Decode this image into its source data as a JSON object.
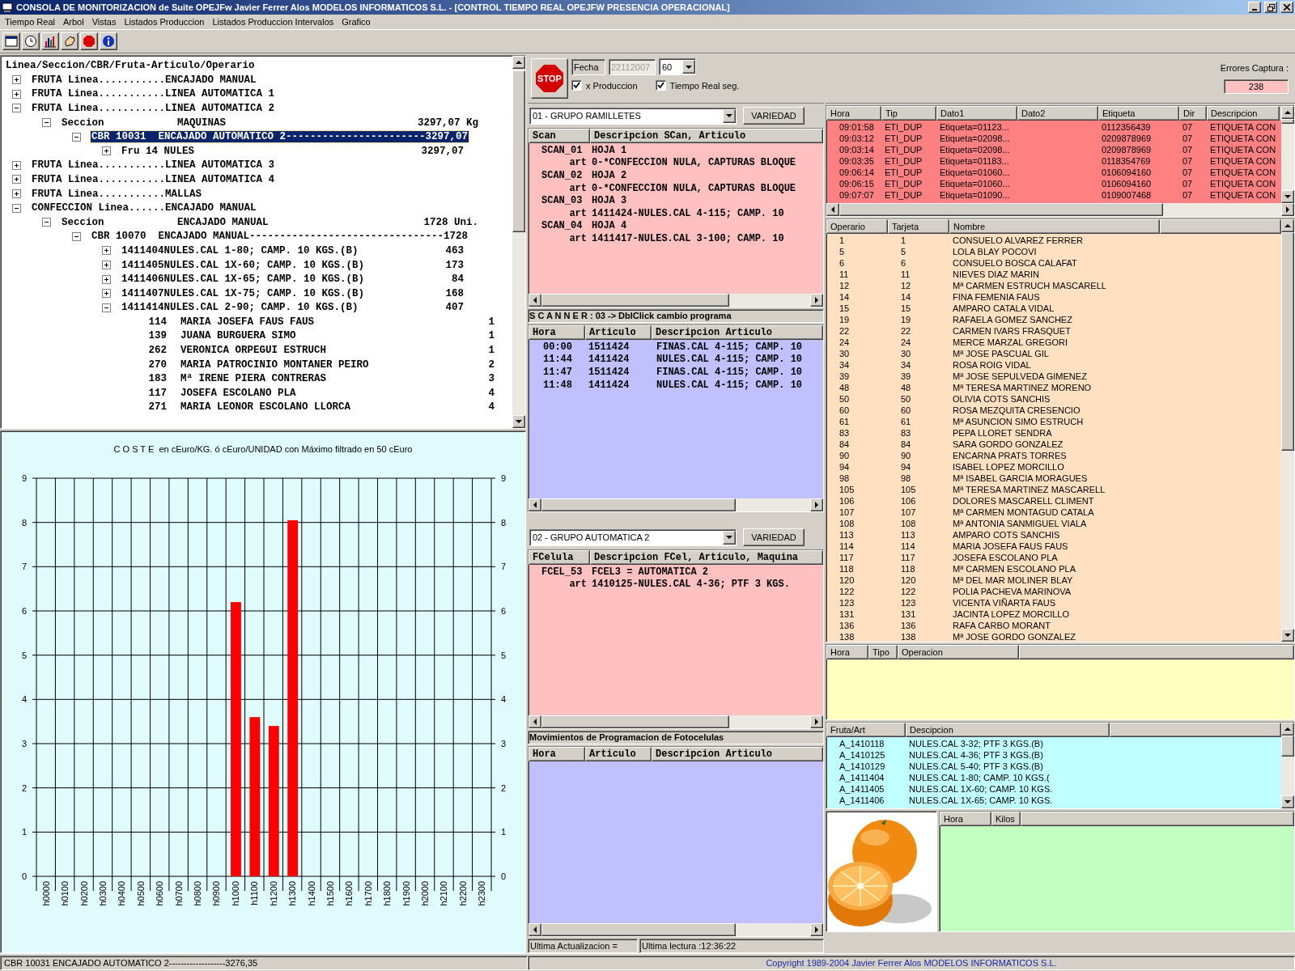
{
  "window": {
    "title": "CONSOLA DE MONITORIZACION de Suite OPEJFw Javier Ferrer Alos MODELOS INFORMATICOS S.L. - [CONTROL TIEMPO REAL OPEJFW PRESENCIA OPERACIONAL]"
  },
  "menu": [
    "Tiempo Real",
    "Arbol",
    "Vistas",
    "Listados Produccion",
    "Listados Produccion Intervalos",
    "Grafico"
  ],
  "tree": {
    "header": "Linea/Seccion/CBR/Fruta-Articulo/Operario",
    "items": [
      {
        "label": "FRUTA Linea...........ENCAJADO MANUAL",
        "expanded": false,
        "selected": false
      },
      {
        "label": "FRUTA Linea...........LINEA AUTOMATICA 1",
        "expanded": false,
        "selected": false
      },
      {
        "label": "FRUTA Linea...........LINEA AUTOMATICA 2",
        "expanded": true,
        "selected": false,
        "children": [
          {
            "label": "Seccion",
            "detail": "MAQUINAS",
            "value": "3297,07 Kg",
            "expanded": true,
            "selected": false,
            "children": [
              {
                "label": "CBR 10031  ENCAJADO AUTOMATICO 2-----------------------3297,07",
                "expanded": true,
                "selected": true,
                "children": [
                  {
                    "label": "Fru 14 NULES",
                    "value": "3297,07",
                    "expanded": false,
                    "selected": false
                  }
                ]
              }
            ]
          }
        ]
      },
      {
        "label": "FRUTA Linea...........LINEA AUTOMATICA 3",
        "expanded": false,
        "selected": false
      },
      {
        "label": "FRUTA Linea...........LINEA AUTOMATICA 4",
        "expanded": false,
        "selected": false
      },
      {
        "label": "FRUTA Linea...........MALLAS",
        "expanded": false,
        "selected": false
      },
      {
        "label": "CONFECCION Linea......ENCAJADO MANUAL",
        "expanded": true,
        "selected": false,
        "children": [
          {
            "label": "Seccion",
            "detail": "ENCAJADO MANUAL",
            "value": "1728 Uni.",
            "expanded": true,
            "selected": false,
            "children": [
              {
                "label": "CBR 10070  ENCAJADO MANUAL--------------------------------1728",
                "expanded": true,
                "selected": false,
                "children": [
                  {
                    "label": "1411404NULES.CAL 1-80; CAMP. 10 KGS.(B)",
                    "value": "463",
                    "expanded": false,
                    "selected": false
                  },
                  {
                    "label": "1411405NULES.CAL 1X-60; CAMP. 10 KGS.(B)",
                    "value": "173",
                    "expanded": false,
                    "selected": false
                  },
                  {
                    "label": "1411406NULES.CAL 1X-65; CAMP. 10 KGS.(B)",
                    "value": "84",
                    "expanded": false,
                    "selected": false
                  },
                  {
                    "label": "1411407NULES.CAL 1X-75; CAMP. 10 KGS.(B)",
                    "value": "168",
                    "expanded": false,
                    "selected": false
                  },
                  {
                    "label": "1411414NULES.CAL 2-90; CAMP. 10 KGS.(B)",
                    "value": "407",
                    "expanded": true,
                    "selected": false,
                    "children": [
                      {
                        "label": "114",
                        "detail": "MARIA JOSEFA FAUS FAUS",
                        "value": "1",
                        "selected": false
                      },
                      {
                        "label": "139",
                        "detail": "JUANA BURGUERA SIMO",
                        "value": "1",
                        "selected": false
                      },
                      {
                        "label": "262",
                        "detail": "VERONICA ORPEGUI ESTRUCH",
                        "value": "1",
                        "selected": false
                      },
                      {
                        "label": "270",
                        "detail": "MARIA PATROCINIO MONTANER PEIRO",
                        "value": "2",
                        "selected": false
                      },
                      {
                        "label": "183",
                        "detail": "Mª IRENE PIERA CONTRERAS",
                        "value": "3",
                        "selected": false
                      },
                      {
                        "label": "117",
                        "detail": "JOSEFA ESCOLANO PLA",
                        "value": "4",
                        "selected": false
                      },
                      {
                        "label": "271",
                        "detail": "MARIA LEONOR ESCOLANO LLORCA",
                        "value": "4",
                        "selected": false
                      }
                    ]
                  }
                ]
              }
            ]
          }
        ]
      }
    ]
  },
  "chart": {
    "chart_data": {
      "type": "bar",
      "title": "C O S T E  en cEuro/KG. ó cEuro/UNIDAD con Máximo filtrado en 50 cEuro",
      "categories": [
        "h0000",
        "h0100",
        "h0200",
        "h0300",
        "h0400",
        "h0500",
        "h0600",
        "h0700",
        "h0800",
        "h0900",
        "h1000",
        "h1100",
        "h1200",
        "h1300",
        "h1400",
        "h1500",
        "h1600",
        "h1700",
        "h1800",
        "h1900",
        "h2000",
        "h2100",
        "h2200",
        "h2300"
      ],
      "series": [
        {
          "color": "#ff0000",
          "values": [
            0,
            0,
            0,
            0,
            0,
            0,
            0,
            0,
            0,
            0,
            6.2,
            3.6,
            3.4,
            8.05,
            0,
            0,
            0,
            0,
            0,
            0,
            0,
            0,
            0,
            0
          ]
        }
      ],
      "ylim": [
        0,
        9
      ],
      "yticks": [
        0,
        1,
        2,
        3,
        4,
        5,
        6,
        7,
        8,
        9
      ],
      "grid": true
    },
    "left_axis_ticks": [
      "9",
      "8",
      "7",
      "6",
      "5",
      "4",
      "3",
      "2",
      "1",
      "0"
    ],
    "right_axis_ticks": [
      "9",
      "8",
      "7",
      "6",
      "5",
      "4",
      "3",
      "2",
      "1",
      "0"
    ]
  },
  "controls": {
    "stop_button": "STOP",
    "date_label": "Fecha",
    "date_value": "22112007",
    "interval": "60",
    "checkboxes": [
      {
        "label": "x Produccion",
        "checked": true
      },
      {
        "label": "Tiempo Real seg.",
        "checked": true
      }
    ]
  },
  "scan_group": {
    "combo": "01 - GRUPO RAMILLETES",
    "button": "VARIEDAD",
    "columns": [
      "Scan",
      "Descripcion SCan, Articulo"
    ],
    "rows": [
      {
        "kind": "scan",
        "code": "SCAN_01",
        "text": "HOJA 1"
      },
      {
        "kind": "art",
        "code": "art",
        "text": "0-*CONFECCION NULA, CAPTURAS BLOQUE"
      },
      {
        "kind": "scan",
        "code": "SCAN_02",
        "text": "HOJA 2"
      },
      {
        "kind": "art",
        "code": "art",
        "text": "0-*CONFECCION NULA, CAPTURAS BLOQUE"
      },
      {
        "kind": "scan",
        "code": "SCAN_03",
        "text": "HOJA 3"
      },
      {
        "kind": "art",
        "code": "art",
        "text": "1411424-NULES.CAL 4-115; CAMP. 10"
      },
      {
        "kind": "scan",
        "code": "SCAN_04",
        "text": "HOJA 4"
      },
      {
        "kind": "art",
        "code": "art",
        "text": "1411417-NULES.CAL 3-100; CAMP. 10"
      }
    ]
  },
  "scanner": {
    "label": "S C A N N E R : 03 -> DblClick cambio programa",
    "columns": [
      "Hora",
      "Articulo",
      "Descripcion Articulo"
    ],
    "rows": [
      [
        "00:00",
        "1511424",
        "FINAS.CAL 4-115; CAMP. 10"
      ],
      [
        "11:44",
        "1411424",
        "NULES.CAL 4-115; CAMP. 10"
      ],
      [
        "11:47",
        "1511424",
        "FINAS.CAL 4-115; CAMP. 10"
      ],
      [
        "11:48",
        "1411424",
        "NULES.CAL 4-115; CAMP. 10"
      ]
    ]
  },
  "fcel_group": {
    "combo": "02 - GRUPO AUTOMATICA 2",
    "button": "VARIEDAD",
    "columns": [
      "FCelula",
      "Descripcion FCel, Articulo, Maquina"
    ],
    "rows": [
      {
        "kind": "scan",
        "code": "FCEL_53",
        "text": "FCEL3 = AUTOMATICA 2"
      },
      {
        "kind": "art",
        "code": "art",
        "text": "1410125-NULES.CAL 4-36; PTF 3 KGS."
      }
    ]
  },
  "movements": {
    "label": "Movimientos de Programacion de Fotocelulas",
    "columns": [
      "Hora",
      "Articulo",
      "Descripcion Articulo"
    ]
  },
  "update_status": {
    "last_update": "Ultima Actualizacion =",
    "last_read": "Ultima lectura :12:36:22"
  },
  "errors": {
    "label": "Errores Captura :",
    "count": "238",
    "columns": [
      "Hora",
      "Tip",
      "Dato1",
      "Dato2",
      "Etiqueta",
      "Dir",
      "Descripcion"
    ],
    "rows": [
      [
        "09:01:58",
        "ETI_DUP",
        "Etiqueta=01123...",
        "",
        "0112356439",
        "07",
        "ETIQUETA CON"
      ],
      [
        "09:03:12",
        "ETI_DUP",
        "Etiqueta=02098...",
        "",
        "0209878969",
        "07",
        "ETIQUETA CON"
      ],
      [
        "09:03:14",
        "ETI_DUP",
        "Etiqueta=02098...",
        "",
        "0209878969",
        "07",
        "ETIQUETA CON"
      ],
      [
        "09:03:35",
        "ETI_DUP",
        "Etiqueta=01183...",
        "",
        "0118354769",
        "07",
        "ETIQUETA CON"
      ],
      [
        "09:06:14",
        "ETI_DUP",
        "Etiqueta=01060...",
        "",
        "0106094160",
        "07",
        "ETIQUETA CON"
      ],
      [
        "09:06:15",
        "ETI_DUP",
        "Etiqueta=01060...",
        "",
        "0106094160",
        "07",
        "ETIQUETA CON"
      ],
      [
        "09:07:07",
        "ETI_DUP",
        "Etiqueta=01090...",
        "",
        "0109007468",
        "07",
        "ETIQUETA CON"
      ]
    ]
  },
  "operators": {
    "columns": [
      "Operario",
      "Tarjeta",
      "Nombre"
    ],
    "rows": [
      [
        "1",
        "1",
        "CONSUELO ALVAREZ FERRER"
      ],
      [
        "5",
        "5",
        "LOLA BLAY POCOVI"
      ],
      [
        "6",
        "6",
        "CONSUELO BOSCA CALAFAT"
      ],
      [
        "11",
        "11",
        "NIEVES DIAZ MARIN"
      ],
      [
        "12",
        "12",
        "Mª CARMEN ESTRUCH MASCARELL"
      ],
      [
        "14",
        "14",
        "FINA FEMENIA FAUS"
      ],
      [
        "15",
        "15",
        "AMPARO CATALA VIDAL"
      ],
      [
        "19",
        "19",
        "RAFAELA GOMEZ SANCHEZ"
      ],
      [
        "22",
        "22",
        "CARMEN IVARS FRASQUET"
      ],
      [
        "24",
        "24",
        "MERCE MARZAL GREGORI"
      ],
      [
        "30",
        "30",
        "Mª JOSE PASCUAL GIL"
      ],
      [
        "34",
        "34",
        "ROSA ROIG VIDAL"
      ],
      [
        "39",
        "39",
        "Mª JOSE SEPULVEDA GIMENEZ"
      ],
      [
        "48",
        "48",
        "Mª TERESA MARTINEZ MORENO"
      ],
      [
        "50",
        "50",
        "OLIVIA COTS SANCHIS"
      ],
      [
        "60",
        "60",
        "ROSA MEZQUITA CRESENCIO"
      ],
      [
        "61",
        "61",
        "Mª ASUNCION SIMO ESTRUCH"
      ],
      [
        "83",
        "83",
        "PEPA LLORET SENDRA"
      ],
      [
        "84",
        "84",
        "SARA GORDO GONZALEZ"
      ],
      [
        "90",
        "90",
        "ENCARNA PRATS TORRES"
      ],
      [
        "94",
        "94",
        "ISABEL LOPEZ MORCILLO"
      ],
      [
        "98",
        "98",
        "Mª ISABEL GARCIA MORAGUES"
      ],
      [
        "105",
        "105",
        "Mª TERESA MARTINEZ MASCARELL"
      ],
      [
        "106",
        "106",
        "DOLORES MASCARELL CLIMENT"
      ],
      [
        "107",
        "107",
        "Mª CARMEN MONTAGUD CATALA"
      ],
      [
        "108",
        "108",
        "Mª ANTONIA SANMIGUEL VIALA"
      ],
      [
        "113",
        "113",
        "AMPARO COTS SANCHIS"
      ],
      [
        "114",
        "114",
        "MARIA JOSEFA FAUS FAUS"
      ],
      [
        "117",
        "117",
        "JOSEFA ESCOLANO PLA"
      ],
      [
        "118",
        "118",
        "Mª CARMEN ESCOLANO PLA"
      ],
      [
        "120",
        "120",
        "Mª DEL MAR MOLINER BLAY"
      ],
      [
        "122",
        "122",
        "POLIA PACHEVA MARINOVA"
      ],
      [
        "123",
        "123",
        "VICENTA VIÑARTA FAUS"
      ],
      [
        "131",
        "131",
        "JACINTA LOPEZ MORCILLO"
      ],
      [
        "136",
        "136",
        "RAFA CARBO MORANT"
      ],
      [
        "138",
        "138",
        "Mª JOSE GORDO GONZALEZ"
      ]
    ]
  },
  "operations": {
    "columns": [
      "Hora",
      "Tipo",
      "Operacion"
    ]
  },
  "fruits": {
    "columns": [
      "Fruta/Art",
      "Descipcion"
    ],
    "rows": [
      [
        "A_1410118",
        "NULES.CAL 3-32; PTF 3 KGS.(B)"
      ],
      [
        "A_1410125",
        "NULES.CAL 4-36; PTF 3 KGS.(B)"
      ],
      [
        "A_1410129",
        "NULES.CAL 5-40; PTF 3 KGS.(B)"
      ],
      [
        "A_1411404",
        "NULES.CAL 1-80; CAMP. 10 KGS.("
      ],
      [
        "A_1411405",
        "NULES.CAL 1X-60; CAMP. 10 KGS."
      ],
      [
        "A_1411406",
        "NULES.CAL 1X-65; CAMP. 10 KGS."
      ]
    ]
  },
  "fruit_image": {
    "kind": "picture"
  },
  "weights": {
    "columns": [
      "Hora",
      "Kilos"
    ]
  },
  "status_bar": {
    "left": "CBR 10031   ENCAJADO AUTOMATICO 2-------------------3276,35",
    "copyright": "Copyright 1989-2004 Javier Ferrer Alos MODELOS INFORMATICOS S.L."
  }
}
